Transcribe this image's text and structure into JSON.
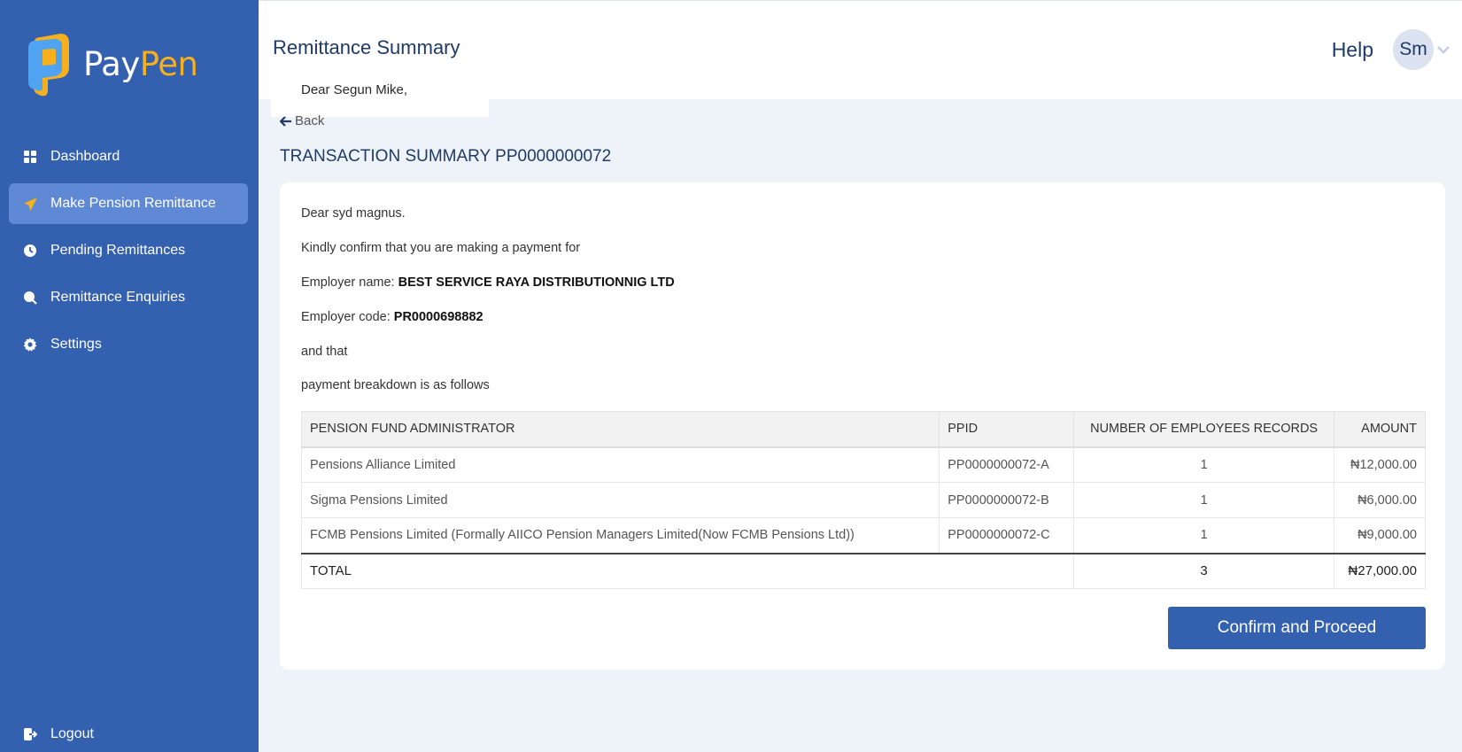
{
  "brand": {
    "name_part1": "Pay",
    "name_part2": "Pen",
    "primary_color": "#3460b0",
    "accent_color": "#f6b01e"
  },
  "sidebar": {
    "items": [
      {
        "label": "Dashboard",
        "icon": "grid-icon",
        "active": false
      },
      {
        "label": "Make Pension Remittance",
        "icon": "paper-plane-icon",
        "active": true
      },
      {
        "label": "Pending Remittances",
        "icon": "clock-icon",
        "active": false
      },
      {
        "label": "Remittance Enquiries",
        "icon": "search-icon",
        "active": false
      },
      {
        "label": "Settings",
        "icon": "gear-icon",
        "active": false
      }
    ],
    "logout_label": "Logout"
  },
  "header": {
    "title": "Remittance Summary",
    "help_label": "Help",
    "avatar_initials": "Sm",
    "greeting": "Dear Segun Mike,"
  },
  "page": {
    "back_label": "Back",
    "summary_title": "TRANSACTION SUMMARY PP0000000072"
  },
  "summary": {
    "salutation": "Dear syd magnus.",
    "confirm_text": "Kindly confirm that you are making a payment for",
    "employer_name_label": "Employer name:",
    "employer_name": "BEST SERVICE RAYA DISTRIBUTIONNIG LTD",
    "employer_code_label": "Employer code:",
    "employer_code": "PR0000698882",
    "and_that": "and that",
    "breakdown_intro": "payment breakdown is as follows"
  },
  "table": {
    "headers": [
      "PENSION FUND ADMINISTRATOR",
      "PPID",
      "NUMBER OF EMPLOYEES RECORDS",
      "AMOUNT"
    ],
    "rows": [
      [
        "Pensions Alliance Limited",
        "PP0000000072-A",
        "1",
        "₦12,000.00"
      ],
      [
        "Sigma Pensions Limited",
        "PP0000000072-B",
        "1",
        "₦6,000.00"
      ],
      [
        "FCMB Pensions Limited (Formally AIICO Pension Managers Limited(Now FCMB Pensions Ltd))",
        "PP0000000072-C",
        "1",
        "₦9,000.00"
      ]
    ],
    "total": {
      "label": "TOTAL",
      "count": "3",
      "amount": "₦27,000.00"
    }
  },
  "actions": {
    "confirm_label": "Confirm and Proceed"
  }
}
